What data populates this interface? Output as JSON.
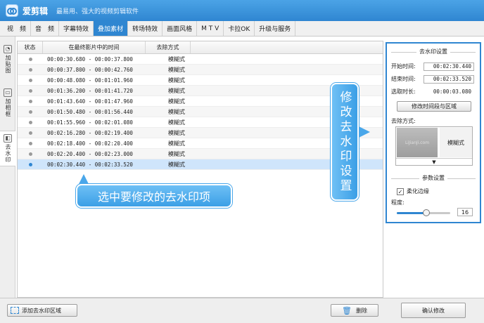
{
  "app": {
    "name": "爱剪辑",
    "slogan": "最易用、强大的视频剪辑软件"
  },
  "tabs": [
    {
      "label": "视　频"
    },
    {
      "label": "音　频"
    },
    {
      "label": "字幕特效"
    },
    {
      "label": "叠加素材",
      "active": true
    },
    {
      "label": "转场特效"
    },
    {
      "label": "画面风格"
    },
    {
      "label": "M T V"
    },
    {
      "label": "卡拉OK"
    },
    {
      "label": "升级与服务"
    }
  ],
  "side_tabs": [
    {
      "label": "加贴图",
      "icon": "sticker-icon"
    },
    {
      "label": "加相框",
      "icon": "frame-icon"
    },
    {
      "label": "去水印",
      "icon": "watermark-icon",
      "active": true
    }
  ],
  "table": {
    "headers": [
      "状态",
      "在最终影片中的时间",
      "去除方式"
    ],
    "rows": [
      {
        "time": "00:00:30.680 - 00:00:37.800",
        "method": "模糊式"
      },
      {
        "time": "00:00:37.800 - 00:00:42.760",
        "method": "模糊式"
      },
      {
        "time": "00:00:48.080 - 00:01:01.960",
        "method": "模糊式"
      },
      {
        "time": "00:01:36.200 - 00:01:41.720",
        "method": "模糊式"
      },
      {
        "time": "00:01:43.640 - 00:01:47.960",
        "method": "模糊式"
      },
      {
        "time": "00:01:50.480 - 00:01:56.440",
        "method": "模糊式"
      },
      {
        "time": "00:01:55.960 - 00:02:01.080",
        "method": "模糊式"
      },
      {
        "time": "00:02:16.280 - 00:02:19.400",
        "method": "模糊式"
      },
      {
        "time": "00:02:18.400 - 00:02:20.400",
        "method": "模糊式"
      },
      {
        "time": "00:02:20.400 - 00:02:23.000",
        "method": "模糊式"
      },
      {
        "time": "00:02:30.440 - 00:02:33.520",
        "method": "模糊式",
        "selected": true
      }
    ]
  },
  "callouts": {
    "select_item": "选中要修改的去水印项",
    "modify_settings": "修改去水印设置"
  },
  "panel": {
    "group1_title": "去水印设置",
    "start_label": "开始时间:",
    "start_value": "00:02:30.440",
    "end_label": "结束时间:",
    "end_value": "00:02:33.520",
    "duration_label": "选取时长:",
    "duration_value": "00:00:03.080",
    "modify_range_button": "修改时间段与区域",
    "method_label": "去除方式:",
    "method_value": "模糊式",
    "method_preview_text": "LiJianJi.com",
    "dropdown_arrow": "▼",
    "group2_title": "参数设置",
    "soften_label": "柔化边缘",
    "soften_checked": true,
    "degree_label": "程度:",
    "degree_value": "16",
    "degree_fraction": 0.55
  },
  "bottom": {
    "add_button": "添加去水印区域",
    "delete_button": "删除",
    "confirm_button": "确认修改"
  }
}
